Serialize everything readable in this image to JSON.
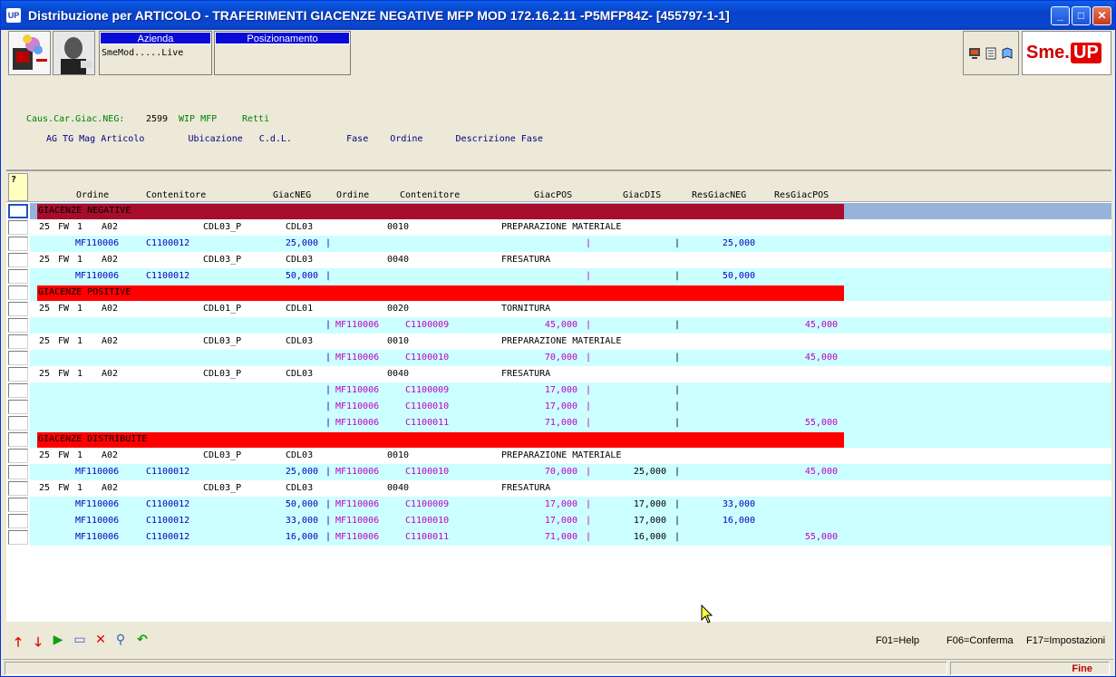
{
  "window": {
    "title": "Distribuzione per ARTICOLO -  TRAFERIMENTI GIACENZE NEGATIVE MFP MOD 172.16.2.11 -P5MFP84Z- [455797-1-1]",
    "icon": "UP",
    "minimize": "_",
    "maximize": "□",
    "close": "✕"
  },
  "toolbar": {
    "azienda_label": "Azienda",
    "azienda_value": "SmeMod.....Live",
    "posizionamento_label": "Posizionamento",
    "posizionamento_value": "",
    "logo_left": "Sme.",
    "logo_right": "UP"
  },
  "header": {
    "line1_label": "Caus.Car.Giac.NEG:",
    "line1_code": "2599",
    "line1_desc": "WIP MFP",
    "line1_extra": "Retti",
    "line2": "AG TG Mag Articolo        Ubicazione   C.d.L.          Fase    Ordine      Descrizione Fase"
  },
  "grid": {
    "corner": "?",
    "columns": [
      "Ordine",
      "Contenitore",
      "GiacNEG",
      "Ordine",
      "Contenitore",
      "GiacPOS",
      "GiacDIS",
      "ResGiacNEG",
      "ResGiacPOS"
    ],
    "rows": [
      {
        "type": "sec",
        "color": "dark",
        "text": "GIACENZE NEGATIVE",
        "cur": true
      },
      {
        "type": "art",
        "ag": "25",
        "tg": "FW",
        "mag": "1",
        "art": "A02",
        "ubi": "CDL03_P",
        "cdl": "CDL03",
        "fase": "0010",
        "desc": "PREPARAZIONE MATERIALE"
      },
      {
        "type": "det",
        "neg_ord": "MF110006",
        "neg_cont": "C1100012",
        "neg": "25,000",
        "pos_ord": "",
        "pos_cont": "",
        "pos": "",
        "dis": "",
        "resneg": "25,000",
        "respos": "",
        "bar": true
      },
      {
        "type": "art",
        "ag": "25",
        "tg": "FW",
        "mag": "1",
        "art": "A02",
        "ubi": "CDL03_P",
        "cdl": "CDL03",
        "fase": "0040",
        "desc": "FRESATURA"
      },
      {
        "type": "det",
        "neg_ord": "MF110006",
        "neg_cont": "C1100012",
        "neg": "50,000",
        "pos_ord": "",
        "pos_cont": "",
        "pos": "",
        "dis": "",
        "resneg": "50,000",
        "respos": "",
        "bar": true
      },
      {
        "type": "sec",
        "color": "red",
        "text": "GIACENZE POSITIVE"
      },
      {
        "type": "art",
        "ag": "25",
        "tg": "FW",
        "mag": "1",
        "art": "A02",
        "ubi": "CDL01_P",
        "cdl": "CDL01",
        "fase": "0020",
        "desc": "TORNITURA"
      },
      {
        "type": "det",
        "neg_ord": "",
        "neg_cont": "",
        "neg": "",
        "pos_ord": "MF110006",
        "pos_cont": "C1100009",
        "pos": "45,000",
        "dis": "",
        "resneg": "",
        "respos": "45,000",
        "bar": true
      },
      {
        "type": "art",
        "ag": "25",
        "tg": "FW",
        "mag": "1",
        "art": "A02",
        "ubi": "CDL03_P",
        "cdl": "CDL03",
        "fase": "0010",
        "desc": "PREPARAZIONE MATERIALE"
      },
      {
        "type": "det",
        "neg_ord": "",
        "neg_cont": "",
        "neg": "",
        "pos_ord": "MF110006",
        "pos_cont": "C1100010",
        "pos": "70,000",
        "dis": "",
        "resneg": "",
        "respos": "45,000",
        "bar": true
      },
      {
        "type": "art",
        "ag": "25",
        "tg": "FW",
        "mag": "1",
        "art": "A02",
        "ubi": "CDL03_P",
        "cdl": "CDL03",
        "fase": "0040",
        "desc": "FRESATURA"
      },
      {
        "type": "det",
        "neg_ord": "",
        "neg_cont": "",
        "neg": "",
        "pos_ord": "MF110006",
        "pos_cont": "C1100009",
        "pos": "17,000",
        "dis": "",
        "resneg": "",
        "respos": "",
        "bar": true
      },
      {
        "type": "det",
        "neg_ord": "",
        "neg_cont": "",
        "neg": "",
        "pos_ord": "MF110006",
        "pos_cont": "C1100010",
        "pos": "17,000",
        "dis": "",
        "resneg": "",
        "respos": "",
        "bar": true
      },
      {
        "type": "det",
        "neg_ord": "",
        "neg_cont": "",
        "neg": "",
        "pos_ord": "MF110006",
        "pos_cont": "C1100011",
        "pos": "71,000",
        "dis": "",
        "resneg": "",
        "respos": "55,000",
        "bar": true
      },
      {
        "type": "sec",
        "color": "red",
        "text": "GIACENZE DISTRIBUITE"
      },
      {
        "type": "art",
        "ag": "25",
        "tg": "FW",
        "mag": "1",
        "art": "A02",
        "ubi": "CDL03_P",
        "cdl": "CDL03",
        "fase": "0010",
        "desc": "PREPARAZIONE MATERIALE"
      },
      {
        "type": "det",
        "neg_ord": "MF110006",
        "neg_cont": "C1100012",
        "neg": "25,000",
        "pos_ord": "MF110006",
        "pos_cont": "C1100010",
        "pos": "70,000",
        "dis": "25,000",
        "resneg": "",
        "respos": "45,000",
        "bar": true
      },
      {
        "type": "art",
        "ag": "25",
        "tg": "FW",
        "mag": "1",
        "art": "A02",
        "ubi": "CDL03_P",
        "cdl": "CDL03",
        "fase": "0040",
        "desc": "FRESATURA"
      },
      {
        "type": "det",
        "neg_ord": "MF110006",
        "neg_cont": "C1100012",
        "neg": "50,000",
        "pos_ord": "MF110006",
        "pos_cont": "C1100009",
        "pos": "17,000",
        "dis": "17,000",
        "resneg": "33,000",
        "respos": "",
        "bar": true
      },
      {
        "type": "det",
        "neg_ord": "MF110006",
        "neg_cont": "C1100012",
        "neg": "33,000",
        "pos_ord": "MF110006",
        "pos_cont": "C1100010",
        "pos": "17,000",
        "dis": "17,000",
        "resneg": "16,000",
        "respos": "",
        "bar": true
      },
      {
        "type": "det",
        "neg_ord": "MF110006",
        "neg_cont": "C1100012",
        "neg": "16,000",
        "pos_ord": "MF110006",
        "pos_cont": "C1100011",
        "pos": "71,000",
        "dis": "16,000",
        "resneg": "",
        "respos": "55,000",
        "bar": true
      }
    ]
  },
  "footer": {
    "f01": "F01=Help",
    "f06": "F06=Conferma",
    "f17": "F17=Impostazioni",
    "status": "Fine"
  },
  "colors": {
    "sec_dark": "#a80d2c",
    "sec_red": "#ff0000",
    "row_cyan": "#ccffff",
    "neg_blue": "#0000c0",
    "pos_magenta": "#c000c0",
    "header_green": "#008000"
  }
}
